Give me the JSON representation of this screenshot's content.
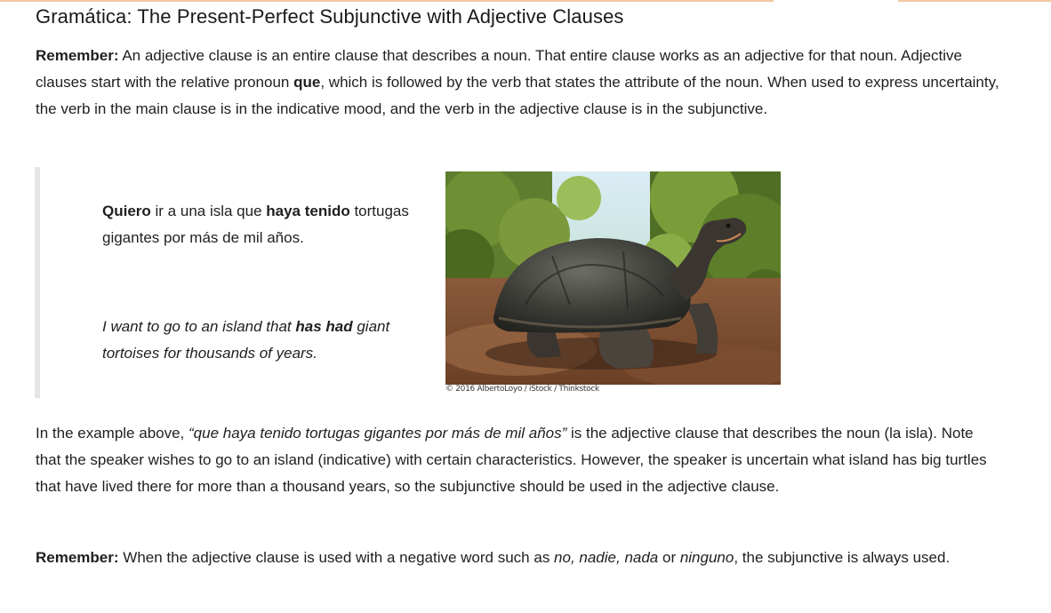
{
  "title": "Gramática: The Present-Perfect Subjunctive with Adjective Clauses",
  "para1": {
    "lead": "Remember:",
    "text_a": " An adjective clause is an entire clause that describes a noun. That entire clause works as an adjective for that noun. Adjective clauses start with the relative pronoun ",
    "bold_word": "que",
    "text_b": ", which is followed by the verb that states the attribute of the noun. When used to express uncertainty, the verb in the main clause is in the indicative mood, and the verb in the adjective clause is in the subjunctive."
  },
  "example": {
    "w1": "Quiero",
    "w2": " ir a una isla que ",
    "w3": "haya tenido",
    "w4": " tortugas gigantes por más de mil años."
  },
  "translation": {
    "t1": "I want to go to an island that ",
    "t2": "has had",
    "t3": " giant tortoises for thousands of years."
  },
  "image": {
    "subject": "giant-tortoise-photo",
    "credit": "© 2016 AlbertoLoyo / iStock / Thinkstock"
  },
  "para2": {
    "a": "In the example above, ",
    "quote": "“que haya tenido tortugas gigantes por más de mil años”",
    "b": " is the adjective clause that describes the noun (la isla). Note that the speaker wishes to go to an island (indicative) with certain characteristics. However, the speaker is uncertain what island has big turtles that have lived there for more than a thousand years, so the subjunctive should be used in the adjective clause."
  },
  "para3": {
    "lead": "Remember:",
    "a": " When the adjective clause is used with a negative word such as ",
    "w1": "no, nadie, nada",
    "b": " or ",
    "w2": "ninguno",
    "c": ", the subjunctive is always used."
  },
  "colors": {
    "rule": "#f2c9a0",
    "quote_bar": "#e6e6e6",
    "text": "#1f1f1f"
  }
}
